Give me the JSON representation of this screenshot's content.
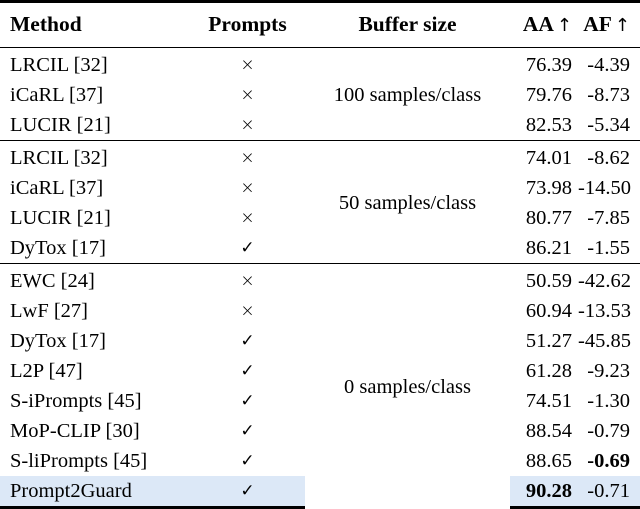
{
  "table": {
    "columns": [
      {
        "key": "method",
        "label": "Method",
        "align": "left"
      },
      {
        "key": "prompts",
        "label": "Prompts",
        "align": "center"
      },
      {
        "key": "buffer",
        "label": "Buffer size",
        "align": "center"
      },
      {
        "key": "aa",
        "label": "AA",
        "arrow": "↑",
        "align": "right"
      },
      {
        "key": "af",
        "label": "AF",
        "arrow": "↑",
        "align": "right"
      }
    ],
    "symbols": {
      "check": "✓",
      "cross": "×"
    },
    "highlight_color": "#dce8f7",
    "groups": [
      {
        "buffer_label": "100 samples/class",
        "rows": [
          {
            "method": "LRCIL [32]",
            "prompts": "×",
            "aa": "76.39",
            "af": "-4.39",
            "aa_bold": false,
            "af_bold": false
          },
          {
            "method": "iCaRL [37]",
            "prompts": "×",
            "aa": "79.76",
            "af": "-8.73",
            "aa_bold": false,
            "af_bold": false
          },
          {
            "method": "LUCIR [21]",
            "prompts": "×",
            "aa": "82.53",
            "af": "-5.34",
            "aa_bold": false,
            "af_bold": false
          }
        ]
      },
      {
        "buffer_label": "50 samples/class",
        "rows": [
          {
            "method": "LRCIL [32]",
            "prompts": "×",
            "aa": "74.01",
            "af": "-8.62",
            "aa_bold": false,
            "af_bold": false
          },
          {
            "method": "iCaRL [37]",
            "prompts": "×",
            "aa": "73.98",
            "af": "-14.50",
            "aa_bold": false,
            "af_bold": false
          },
          {
            "method": "LUCIR [21]",
            "prompts": "×",
            "aa": "80.77",
            "af": "-7.85",
            "aa_bold": false,
            "af_bold": false
          },
          {
            "method": "DyTox [17]",
            "prompts": "✓",
            "aa": "86.21",
            "af": "-1.55",
            "aa_bold": false,
            "af_bold": false
          }
        ]
      },
      {
        "buffer_label": "0 samples/class",
        "rows": [
          {
            "method": "EWC [24]",
            "prompts": "×",
            "aa": "50.59",
            "af": "-42.62",
            "aa_bold": false,
            "af_bold": false,
            "highlight": false
          },
          {
            "method": "LwF [27]",
            "prompts": "×",
            "aa": "60.94",
            "af": "-13.53",
            "aa_bold": false,
            "af_bold": false,
            "highlight": false
          },
          {
            "method": "DyTox [17]",
            "prompts": "✓",
            "aa": "51.27",
            "af": "-45.85",
            "aa_bold": false,
            "af_bold": false,
            "highlight": false
          },
          {
            "method": "L2P [47]",
            "prompts": "✓",
            "aa": "61.28",
            "af": "-9.23",
            "aa_bold": false,
            "af_bold": false,
            "highlight": false
          },
          {
            "method": "S-iPrompts [45]",
            "prompts": "✓",
            "aa": "74.51",
            "af": "-1.30",
            "aa_bold": false,
            "af_bold": false,
            "highlight": false
          },
          {
            "method": "MoP-CLIP [30]",
            "prompts": "✓",
            "aa": "88.54",
            "af": "-0.79",
            "aa_bold": false,
            "af_bold": false,
            "highlight": false
          },
          {
            "method": "S-liPrompts [45]",
            "prompts": "✓",
            "aa": "88.65",
            "af": "-0.69",
            "aa_bold": false,
            "af_bold": true,
            "highlight": false
          },
          {
            "method": "Prompt2Guard",
            "prompts": "✓",
            "aa": "90.28",
            "af": "-0.71",
            "aa_bold": true,
            "af_bold": false,
            "highlight": true
          }
        ]
      }
    ]
  }
}
